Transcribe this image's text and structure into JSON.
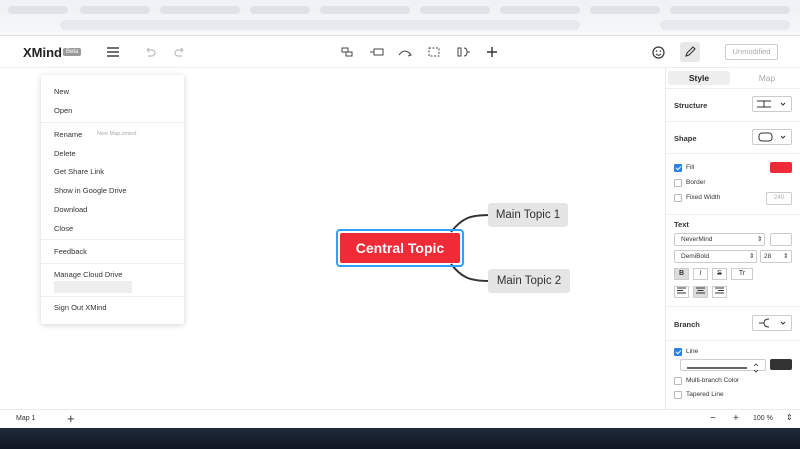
{
  "app": {
    "name": "XMind",
    "badge": "Beta"
  },
  "toolbar": {
    "status_button": "Unmodified"
  },
  "file_menu": {
    "items": [
      {
        "label": "New"
      },
      {
        "label": "Open"
      },
      {
        "label": "Rename",
        "sub": "New Map.xmind"
      },
      {
        "label": "Delete"
      },
      {
        "label": "Get Share Link"
      },
      {
        "label": "Show in Google Drive"
      },
      {
        "label": "Download"
      },
      {
        "label": "Close"
      },
      {
        "label": "Feedback"
      },
      {
        "label": "Manage Cloud Drive"
      },
      {
        "label": "Sign Out XMind"
      }
    ]
  },
  "map": {
    "central_topic": "Central Topic",
    "topics": [
      "Main Topic 1",
      "Main Topic 2"
    ],
    "central_color": "#ef2b38"
  },
  "panel": {
    "tabs": [
      "Style",
      "Map"
    ],
    "active_tab": "Style",
    "structure_label": "Structure",
    "shape_label": "Shape",
    "fill_label": "Fill",
    "fill_checked": true,
    "fill_color": "#ef2b38",
    "border_label": "Border",
    "fixed_width_label": "Fixed Width",
    "fixed_width_value": "240",
    "text_label": "Text",
    "font_family": "NeverMind",
    "font_weight": "DemiBold",
    "font_size": "28",
    "branch_label": "Branch",
    "line_label": "Line",
    "line_checked": true,
    "line_color": "#333333",
    "multi_branch_label": "Multi-branch Color",
    "tapered_label": "Tapered Line"
  },
  "status": {
    "sheet_tab": "Map 1",
    "zoom": "100 %"
  }
}
